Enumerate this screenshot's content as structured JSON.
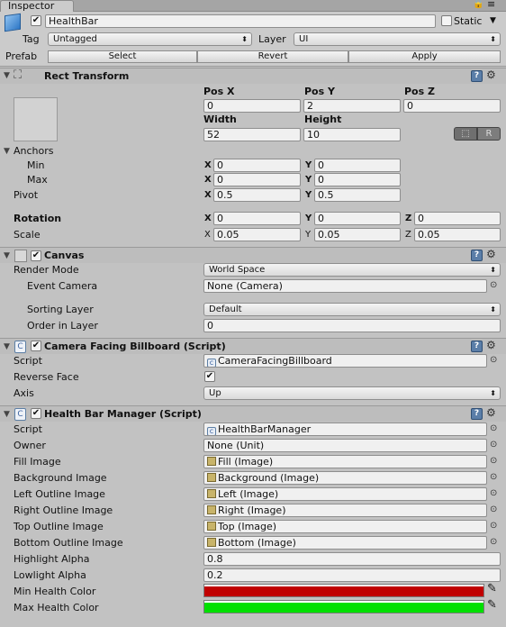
{
  "tab": {
    "title": "Inspector"
  },
  "gameobject": {
    "active": true,
    "name": "HealthBar",
    "static_label": "Static",
    "static_checked": false,
    "tag_label": "Tag",
    "tag_value": "Untagged",
    "layer_label": "Layer",
    "layer_value": "UI",
    "prefab_label": "Prefab",
    "select": "Select",
    "revert": "Revert",
    "apply": "Apply"
  },
  "rect": {
    "title": "Rect Transform",
    "posx_label": "Pos X",
    "posy_label": "Pos Y",
    "posz_label": "Pos Z",
    "posx": "0",
    "posy": "2",
    "posz": "0",
    "width_label": "Width",
    "height_label": "Height",
    "width": "52",
    "height": "10",
    "blueprint_btn": "",
    "raw_btn": "R",
    "anchors_label": "Anchors",
    "min_label": "Min",
    "max_label": "Max",
    "min_x": "0",
    "min_y": "0",
    "max_x": "0",
    "max_y": "0",
    "pivot_label": "Pivot",
    "pivot_x": "0.5",
    "pivot_y": "0.5",
    "rotation_label": "Rotation",
    "rot_x": "0",
    "rot_y": "0",
    "rot_z": "0",
    "scale_label": "Scale",
    "scale_x": "0.05",
    "scale_y": "0.05",
    "scale_z": "0.05",
    "x": "X",
    "y": "Y",
    "z": "Z"
  },
  "canvas": {
    "title": "Canvas",
    "enabled": true,
    "render_mode_label": "Render Mode",
    "render_mode": "World Space",
    "event_camera_label": "Event Camera",
    "event_camera": "None (Camera)",
    "sorting_layer_label": "Sorting Layer",
    "sorting_layer": "Default",
    "order_label": "Order in Layer",
    "order": "0"
  },
  "billboard": {
    "title": "Camera Facing Billboard (Script)",
    "enabled": true,
    "script_label": "Script",
    "script": "CameraFacingBillboard",
    "reverse_label": "Reverse Face",
    "reverse": true,
    "axis_label": "Axis",
    "axis": "Up"
  },
  "manager": {
    "title": "Health Bar Manager (Script)",
    "enabled": true,
    "script_label": "Script",
    "script": "HealthBarManager",
    "owner_label": "Owner",
    "owner": "None (Unit)",
    "fill_label": "Fill Image",
    "fill": "Fill (Image)",
    "bg_label": "Background Image",
    "bg": "Background (Image)",
    "left_label": "Left Outline Image",
    "left": "Left (Image)",
    "right_label": "Right Outline Image",
    "right": "Right (Image)",
    "top_label": "Top Outline Image",
    "top": "Top (Image)",
    "bottom_label": "Bottom Outline Image",
    "bottom": "Bottom (Image)",
    "hi_label": "Highlight Alpha",
    "hi": "0.8",
    "lo_label": "Lowlight Alpha",
    "lo": "0.2",
    "min_color_label": "Min Health Color",
    "min_color": "#c00000",
    "max_color_label": "Max Health Color",
    "max_color": "#00e000"
  },
  "icons": {
    "help": "help-icon",
    "gear": "gear-icon",
    "lock": "lock-icon",
    "menu": "menu-icon",
    "eyedropper": "eyedropper-icon"
  }
}
